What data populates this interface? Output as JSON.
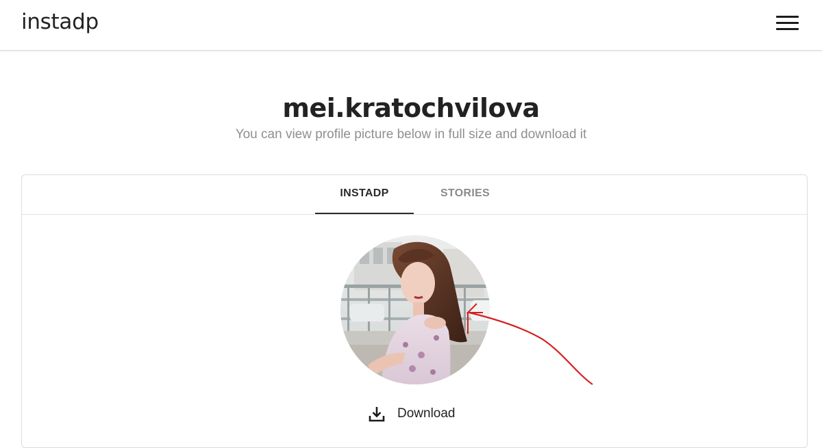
{
  "header": {
    "brand": "instadp",
    "menu_icon": "hamburger-menu-icon"
  },
  "profile": {
    "username": "mei.kratochvilova",
    "subtitle": "You can view profile picture below in full size and download it"
  },
  "tabs": [
    {
      "label": "INSTADP",
      "active": true
    },
    {
      "label": "STORIES",
      "active": false
    }
  ],
  "download": {
    "label": "Download",
    "icon": "download-icon"
  },
  "colors": {
    "text": "#222222",
    "muted": "#8f8f8f",
    "border": "#dcdcdc",
    "annotation": "#d61f1f"
  }
}
